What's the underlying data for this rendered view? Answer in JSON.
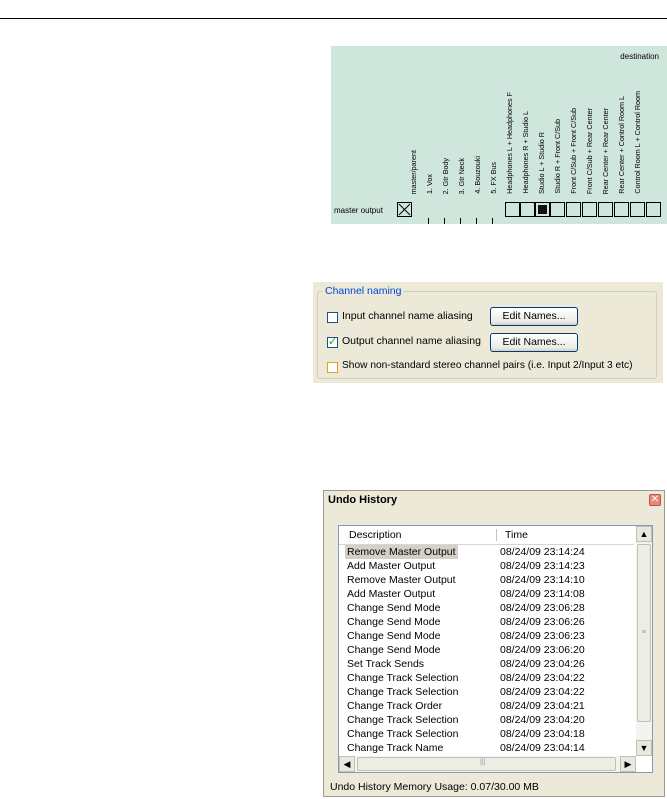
{
  "matrix": {
    "destination_label": "destination",
    "row_label": "master output",
    "columns": [
      "master/parent",
      "1. Vox",
      "2. Gtr Body",
      "3. Gtr Neck",
      "4. Bouzouki",
      "5. FX Bus",
      "Headphones L + Headphones F",
      "Headphones R + Studio L",
      "Studio L + Studio R",
      "Studio R + Front C/Sub",
      "Front C/Sub + Front C/Sub",
      "Front C/Sub + Rear Center",
      "Rear Center + Rear Center",
      "Rear Center + Control Room L",
      "Control Room L + Control Room"
    ]
  },
  "channel_naming": {
    "legend": "Channel naming",
    "input_aliasing": {
      "label": "Input channel name aliasing",
      "checked": false,
      "button": "Edit Names..."
    },
    "output_aliasing": {
      "label": "Output channel name aliasing",
      "checked": true,
      "button": "Edit Names..."
    },
    "nonstandard_pairs": {
      "label": "Show non-standard stereo channel pairs (i.e. Input 2/Input 3 etc)",
      "checked": false
    }
  },
  "undo_history": {
    "title": "Undo History",
    "close": "✕",
    "columns": {
      "description": "Description",
      "time": "Time"
    },
    "rows": [
      {
        "description": "Remove Master Output",
        "time": "08/24/09 23:14:24"
      },
      {
        "description": "Add Master Output",
        "time": "08/24/09 23:14:23"
      },
      {
        "description": "Remove Master Output",
        "time": "08/24/09 23:14:10"
      },
      {
        "description": "Add Master Output",
        "time": "08/24/09 23:14:08"
      },
      {
        "description": "Change Send Mode",
        "time": "08/24/09 23:06:28"
      },
      {
        "description": "Change Send Mode",
        "time": "08/24/09 23:06:26"
      },
      {
        "description": "Change Send Mode",
        "time": "08/24/09 23:06:23"
      },
      {
        "description": "Change Send Mode",
        "time": "08/24/09 23:06:20"
      },
      {
        "description": "Set Track Sends",
        "time": "08/24/09 23:04:26"
      },
      {
        "description": "Change Track Selection",
        "time": "08/24/09 23:04:22"
      },
      {
        "description": "Change Track Selection",
        "time": "08/24/09 23:04:22"
      },
      {
        "description": "Change Track Order",
        "time": "08/24/09 23:04:21"
      },
      {
        "description": "Change Track Selection",
        "time": "08/24/09 23:04:20"
      },
      {
        "description": "Change Track Selection",
        "time": "08/24/09 23:04:18"
      },
      {
        "description": "Change Track Name",
        "time": "08/24/09 23:04:14"
      }
    ],
    "memory_usage": "Undo History Memory Usage: 0.07/30.00 MB"
  }
}
